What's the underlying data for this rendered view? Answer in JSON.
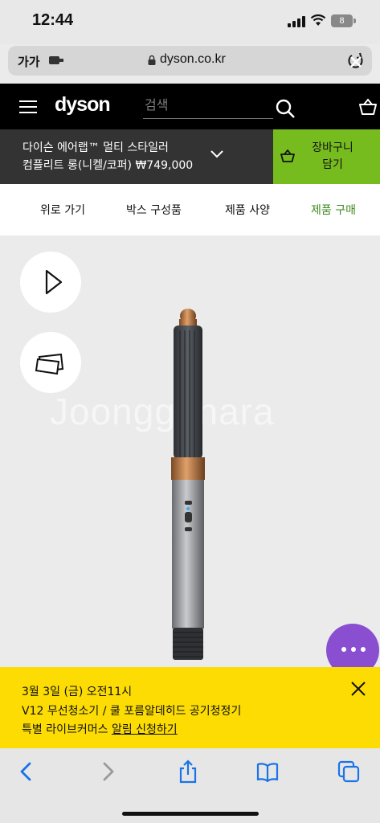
{
  "status": {
    "time": "12:44",
    "battery": "8"
  },
  "browser": {
    "aa_label": "가가",
    "domain": "dyson.co.kr"
  },
  "header": {
    "logo": "dyson",
    "search_placeholder": "검색"
  },
  "product": {
    "name_line1": "다이슨 에어랩™ 멀티 스타일러",
    "name_line2": "컴플리트 롱(니켈/코퍼) ₩749,000"
  },
  "cart": {
    "line1": "장바구니",
    "line2": "담기"
  },
  "tabs": [
    {
      "label": "위로 가기"
    },
    {
      "label": "박스 구성품"
    },
    {
      "label": "제품 사양"
    },
    {
      "label": "제품 구매"
    }
  ],
  "watermark": "Joonggonara",
  "banner": {
    "line1": "3월 3일 (금) 오전11시",
    "line2": "V12 무선청소기 / 쿨 포름알데히드 공기청정기",
    "line3_plain": "특별 라이브커머스 ",
    "line3_link": "알림 신청하기"
  },
  "colors": {
    "accent_green": "#77bc1f",
    "active_tab": "#3c8a1e",
    "banner_yellow": "#fcdc03",
    "chat_purple": "#8a4fd1",
    "ios_blue": "#1a73e8"
  }
}
